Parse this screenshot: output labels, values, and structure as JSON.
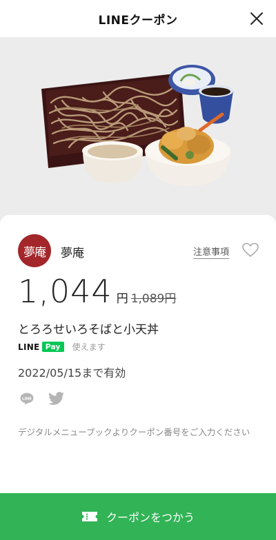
{
  "header": {
    "title": "LINEクーポン"
  },
  "shop": {
    "logo_text": "夢庵",
    "name": "夢庵",
    "notes_label": "注意事項"
  },
  "price": {
    "current": "1,044",
    "unit": "円",
    "original": "1,089円"
  },
  "coupon": {
    "name": "とろろせいろそばと小天丼"
  },
  "pay": {
    "brand_line": "LINE",
    "brand_pay": "Pay",
    "usable_label": "使えます"
  },
  "validity": "2022/05/15まで有効",
  "description": "デジタルメニューブックよりクーポン番号をご入力ください",
  "button": {
    "label": "クーポンをつかう"
  },
  "colors": {
    "accent_green": "#31b356",
    "logo_red": "#a3262a",
    "linepay_green": "#06c755"
  },
  "icons": {
    "close": "close-icon",
    "heart": "heart-icon",
    "share_line": "line-share-icon",
    "share_twitter": "twitter-icon",
    "ticket": "ticket-icon"
  }
}
